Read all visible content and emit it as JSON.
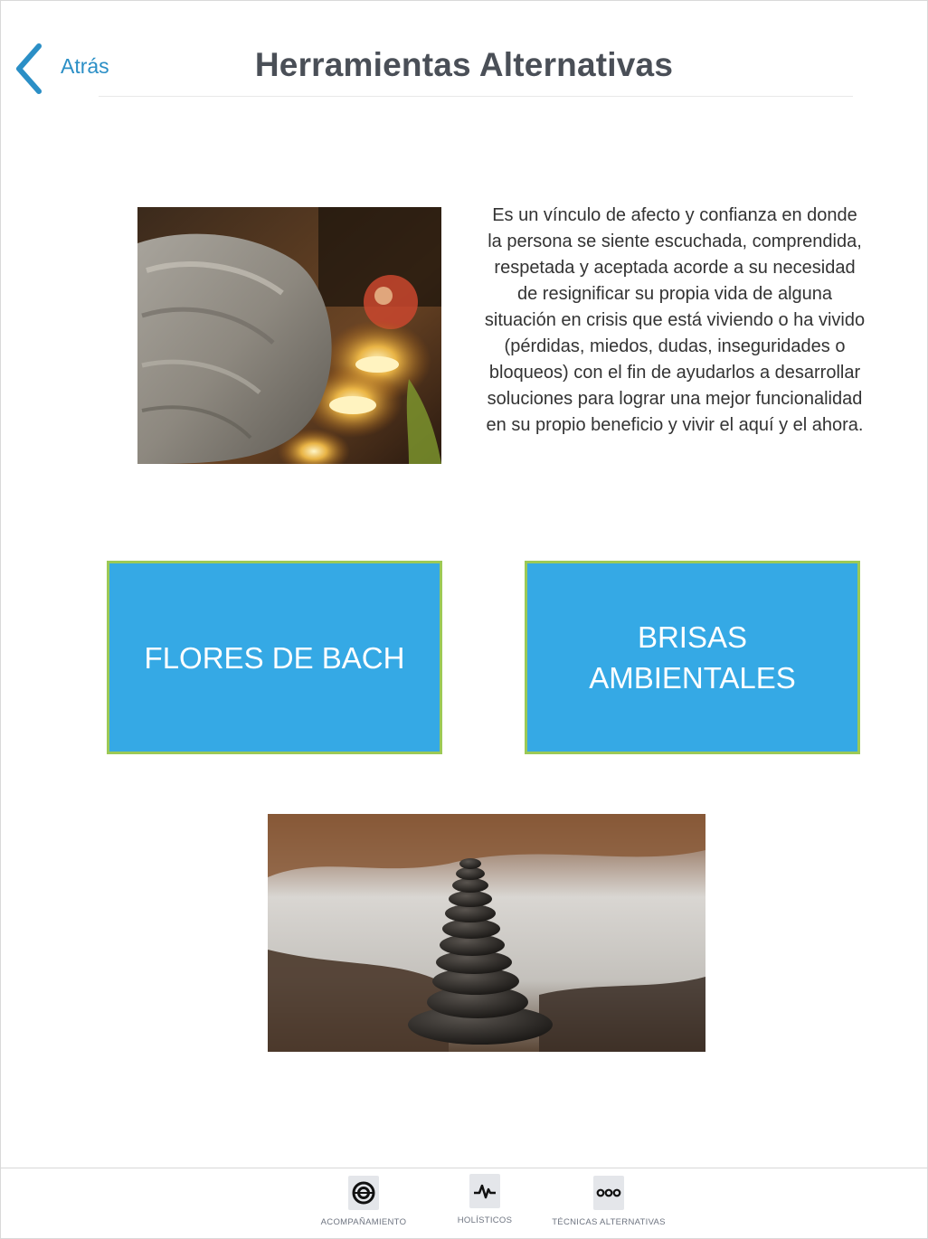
{
  "header": {
    "back_label": "Atrás",
    "title": "Herramientas Alternativas"
  },
  "intro": {
    "description": "Es un vínculo de afecto y confianza en donde la persona se siente escuchada, comprendida, respetada y aceptada acorde a su necesidad de resignificar su propia vida de alguna situación en crisis que está viviendo o ha vivido (pérdidas, miedos, dudas, inseguridades o bloqueos) con el fin de ayudarlos a desarrollar soluciones para lograr una mejor funcionalidad en su propio beneficio y vivir el aquí y el ahora."
  },
  "options": {
    "flores_label": "FLORES DE BACH",
    "brisas_label": "BRISAS AMBIENTALES"
  },
  "tabbar": {
    "items": [
      {
        "label": "ACOMPAÑAMIENTO",
        "icon": "ring-icon"
      },
      {
        "label": "HOLÍSTICOS",
        "icon": "pulse-icon"
      },
      {
        "label": "TÉCNICAS ALTERNATIVAS",
        "icon": "dots-icon"
      }
    ]
  },
  "colors": {
    "accent_blue": "#2b8fc6",
    "tile_fill": "#35a9e5",
    "tile_border": "#9cc956",
    "title_text": "#4a4f57"
  }
}
